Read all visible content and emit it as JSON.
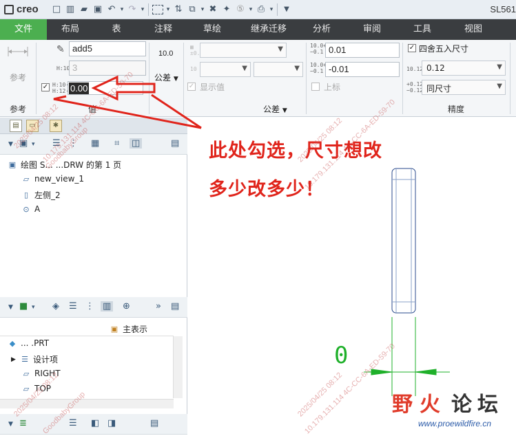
{
  "app": {
    "logo_text": "creo",
    "window_title": "SL561"
  },
  "quick_access": {
    "icons": [
      "new-icon",
      "open-folder-icon",
      "folder-icon",
      "save-icon",
      "undo-icon",
      "dropdown-icon",
      "redo-icon",
      "dropdown-icon",
      "select-box-icon",
      "dropdown-icon",
      "regenerate-icon",
      "window-icon",
      "dropdown-icon",
      "close-window-icon",
      "ipad-icon",
      "step-icon",
      "dropdown-icon",
      "print-icon",
      "dropdown-icon",
      "customize-icon"
    ]
  },
  "ribbon_tabs": [
    "文件",
    "布局",
    "表",
    "注释",
    "草绘",
    "继承迁移",
    "分析",
    "审阅",
    "工具",
    "视图"
  ],
  "active_tab": "文件",
  "ribbon": {
    "ref_group": {
      "button_label": "参考",
      "group_label": "参考"
    },
    "value_group": {
      "name_field": "add5",
      "nominal_field": "3",
      "override_field": "0.00",
      "override_checked": "✓",
      "group_label": "值"
    },
    "tolerance_group": {
      "display_value": "10.0",
      "tolerance_button": "公差",
      "tol_prefix": "±0.1",
      "fit_prefix": "10 h7",
      "show_value_label": "显示值",
      "show_value_checked": "✓",
      "group_label": "公差"
    },
    "tolerance_values": {
      "upper": "0.01",
      "lower": "-0.01",
      "upper_symbol": "10.0+0.2 −0.1",
      "lower_symbol": "10.0+0.2 −0.1",
      "superscript_label": "上标"
    },
    "precision_group": {
      "round_label": "四舍五入尺寸",
      "round_checked": "✓",
      "precision_value": "0.12",
      "precision_symbol": "10.123",
      "tol_precision_value": "同尺寸",
      "tol_precision_symbol": "+0.123 −0.123",
      "group_label": "精度"
    }
  },
  "model_tree_top": {
    "rows": [
      {
        "icon": "drawing-icon",
        "label": "绘图 S... ...DRW 的第 1 页"
      },
      {
        "icon": "view-icon",
        "label": "new_view_1"
      },
      {
        "icon": "view-icon",
        "label": "左侧_2"
      },
      {
        "icon": "view-detail-icon",
        "label": "A"
      }
    ]
  },
  "model_tree_bottom": {
    "main_rep": "主表示",
    "rows": [
      {
        "icon": "part-icon",
        "label": "... .PRT"
      },
      {
        "icon": "design-items-icon",
        "label": "设计项"
      },
      {
        "icon": "datum-plane-icon",
        "label": "RIGHT"
      },
      {
        "icon": "datum-plane-icon",
        "label": "TOP"
      }
    ]
  },
  "canvas": {
    "annotation_line1": "此处勾选，尺寸想改",
    "annotation_line2": "多少改多少！",
    "dimension_text": "0",
    "dimension_color": "#1fb02a",
    "part_outline_color": "#2a4a8c"
  },
  "watermarks": [
    "2025/04/25 08:12",
    "10.179.131.114 4C-CC-6A-ED-59-70",
    "GoodbabyGroup"
  ],
  "brand": {
    "chars": [
      "野",
      "火",
      "论",
      "坛"
    ],
    "url": "www.proewildfire.cn",
    "colors": [
      "#e03b2a",
      "#e03b2a",
      "#333333",
      "#333333"
    ]
  }
}
